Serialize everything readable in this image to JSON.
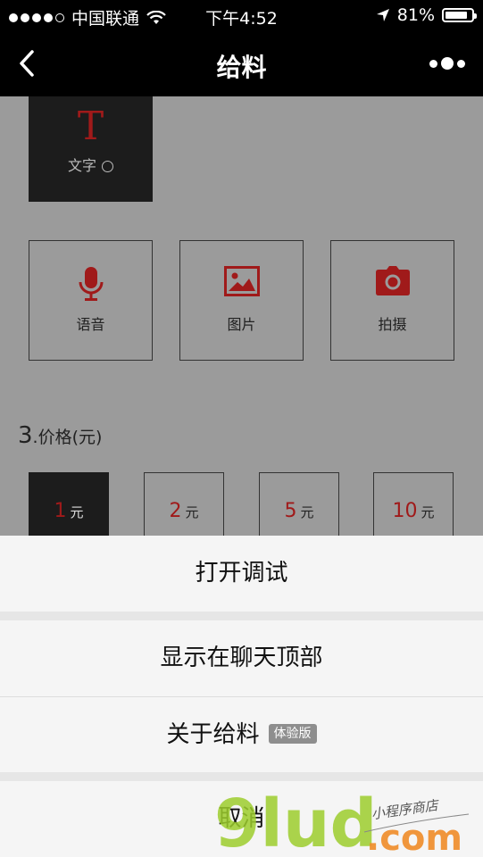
{
  "status_bar": {
    "carrier": "中国联通",
    "time": "下午4:52",
    "battery": "81%"
  },
  "navbar": {
    "title": "给料"
  },
  "text_card": {
    "glyph": "T",
    "label": "文字"
  },
  "media": [
    {
      "label": "语音",
      "icon": "microphone-icon"
    },
    {
      "label": "图片",
      "icon": "image-icon"
    },
    {
      "label": "拍摄",
      "icon": "camera-icon"
    }
  ],
  "price_section": {
    "num": "3",
    "label": ".价格(元)",
    "options": [
      {
        "value": "1",
        "unit": "元",
        "selected": true
      },
      {
        "value": "2",
        "unit": "元",
        "selected": false
      },
      {
        "value": "5",
        "unit": "元",
        "selected": false
      },
      {
        "value": "10",
        "unit": "元",
        "selected": false
      }
    ]
  },
  "action_sheet": {
    "open_debug": "打开调试",
    "show_top": "显示在聊天顶部",
    "about": "关于给料",
    "about_badge": "体验版",
    "cancel": "取消"
  },
  "watermark": {
    "brand": "9lud",
    "domain": ".com",
    "tagline": "小程序商店"
  },
  "colors": {
    "accent": "#a01a1a",
    "overlay": "#9b9b9b",
    "sheet": "#f5f5f5"
  }
}
